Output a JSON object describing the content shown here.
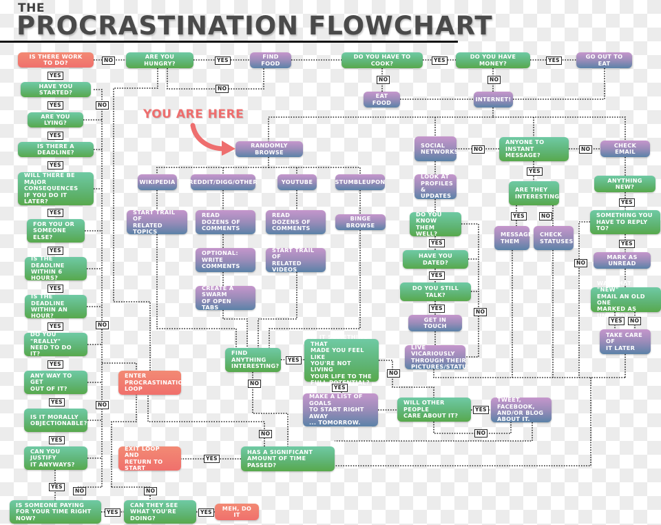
{
  "title": {
    "small": "THE",
    "main": "PROCRASTINATION FLOWCHART"
  },
  "annotation": {
    "you_are_here": "YOU ARE HERE"
  },
  "colors": {
    "question_node": "#5fb474",
    "action_node": "#9a8cb9",
    "terminal_node": "#f0706c",
    "annotation": "#ee6e6e",
    "connector": "#222222"
  },
  "nodes": {
    "work": "IS THERE WORK TO DO?",
    "hungry": "ARE YOU HUNGRY?",
    "find_food": "FIND FOOD",
    "cook": "DO YOU HAVE TO COOK?",
    "money": "DO YOU HAVE MONEY?",
    "go_out": "GO OUT TO EAT",
    "eat_food": "EAT FOOD",
    "internet": "INTERNET!",
    "started": "HAVE YOU STARTED?",
    "lying": "ARE YOU LYING?",
    "deadline": "IS THERE A DEADLINE?",
    "consequences": "WILL THERE BE MAJOR\nCONSEQUENCES\nIF YOU DO IT LATER?",
    "for_you": "FOR YOU OR\nSOMEONE ELSE?",
    "six_hours": "IS THE DEADLINE\nWITHIN 6 HOURS?",
    "an_hour": "IS THE DEADLINE\nWITHIN AN HOUR?",
    "really": "DO YOU \"REALLY\"\nNEED TO DO IT?",
    "any_way": "ANY WAY TO GET\nOUT OF IT?",
    "morally": "IS IT MORALLY\nOBJECTIONABLE?",
    "justify": "CAN YOU JUSTIFY\nIT ANYWAYS?",
    "paying": "IS SOMEONE PAYING\nFOR YOUR TIME RIGHT NOW?",
    "see": "CAN THEY SEE\nWHAT YOU'RE DOING?",
    "meh": "MEH, DO IT",
    "enter_loop": "ENTER\nPROCRASTINATION\nLOOP",
    "exit_loop": "EXIT LOOP AND\nRETURN TO START",
    "randomly": "RANDOMLY BROWSE",
    "wikipedia": "WIKIPEDIA",
    "reddit": "REDDIT/DIGG/OTHER",
    "youtube": "YOUTUBE",
    "stumble": "STUMBLEUPON",
    "trail_topics": "START TRAIL OF\nRELATED TOPICS",
    "read_comments_1": "READ DOZENS OF\nCOMMENTS",
    "read_comments_2": "READ DOZENS OF\nCOMMENTS",
    "binge": "BINGE BROWSE",
    "write_comments": "OPTIONAL:\nWRITE COMMENTS",
    "trail_videos": "START TRAIL OF\nRELATED VIDEOS",
    "swarm": "CREATE A SWARM\nOF OPEN TABS",
    "find_anything": "FIND ANYTHING\nINTERESTING?",
    "potential": "IS IT SOMETHING THAT\nMADE YOU FEEL LIKE\nYOU'RE NOT LIVING\nYOUR LIFE TO THE\nFULL POTENTIAL?",
    "goals": "MAKE A LIST OF GOALS\nTO START RIGHT AWAY\n... TOMORROW.",
    "others_care": "WILL OTHER PEOPLE\nCARE ABOUT IT?",
    "tweet": "TWEET, FACEBOOK,\nAND/OR BLOG\nABOUT IT.",
    "time_passed": "HAS A SIGNIFICANT\nAMOUNT OF TIME PASSED?",
    "social": "SOCIAL\nNETWORKS",
    "profiles": "LOOK AT\nPROFILES &\nUPDATES",
    "know_well": "DO YOU KNOW\nTHEM WELL?",
    "dated": "HAVE YOU DATED?",
    "still_talk": "DO YOU STILL TALK?",
    "get_in_touch": "GET IN TOUCH",
    "vicarious": "LIVE VICARIOUSLY\nTHROUGH THEIR\nPICTURES/STATUS",
    "im": "ANYONE TO\nINSTANT MESSAGE?",
    "interesting": "ARE THEY\nINTERESTING?",
    "message": "MESSAGE\nTHEM",
    "statuses": "CHECK\nSTATUSES",
    "check_email": "CHECK EMAIL",
    "anything_new": "ANYTHING NEW?",
    "reply": "SOMETHING YOU\nHAVE TO REPLY TO?",
    "mark_unread": "MARK AS UNREAD",
    "was_new": "WAS THAT \"NEW\"\nEMAIL AN OLD ONE\nMARKED AS UNREAD?",
    "later": "TAKE CARE OF\nIT LATER"
  },
  "labels": {
    "yes": "YES",
    "no": "NO"
  }
}
